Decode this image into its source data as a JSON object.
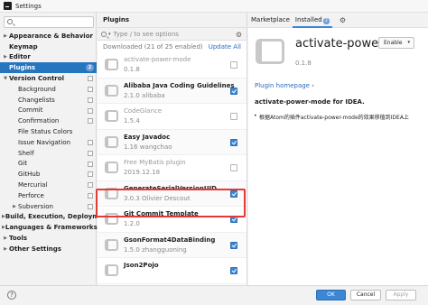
{
  "window": {
    "title": "Settings"
  },
  "sidebar": {
    "search_placeholder": "",
    "items": [
      {
        "label": "Appearance & Behavior",
        "arrow": "▶",
        "bold": true,
        "indent": 0,
        "selected": false,
        "copy": false,
        "badge": ""
      },
      {
        "label": "Keymap",
        "arrow": "",
        "bold": true,
        "indent": 0,
        "selected": false,
        "copy": false,
        "badge": ""
      },
      {
        "label": "Editor",
        "arrow": "▶",
        "bold": true,
        "indent": 0,
        "selected": false,
        "copy": false,
        "badge": ""
      },
      {
        "label": "Plugins",
        "arrow": "",
        "bold": true,
        "indent": 0,
        "selected": true,
        "copy": false,
        "badge": "2"
      },
      {
        "label": "Version Control",
        "arrow": "▼",
        "bold": true,
        "indent": 0,
        "selected": false,
        "copy": true,
        "badge": ""
      },
      {
        "label": "Background",
        "arrow": "",
        "bold": false,
        "indent": 1,
        "selected": false,
        "copy": true,
        "badge": ""
      },
      {
        "label": "Changelists",
        "arrow": "",
        "bold": false,
        "indent": 1,
        "selected": false,
        "copy": true,
        "badge": ""
      },
      {
        "label": "Commit",
        "arrow": "",
        "bold": false,
        "indent": 1,
        "selected": false,
        "copy": true,
        "badge": ""
      },
      {
        "label": "Confirmation",
        "arrow": "",
        "bold": false,
        "indent": 1,
        "selected": false,
        "copy": true,
        "badge": ""
      },
      {
        "label": "File Status Colors",
        "arrow": "",
        "bold": false,
        "indent": 1,
        "selected": false,
        "copy": false,
        "badge": ""
      },
      {
        "label": "Issue Navigation",
        "arrow": "",
        "bold": false,
        "indent": 1,
        "selected": false,
        "copy": true,
        "badge": ""
      },
      {
        "label": "Shelf",
        "arrow": "",
        "bold": false,
        "indent": 1,
        "selected": false,
        "copy": true,
        "badge": ""
      },
      {
        "label": "Git",
        "arrow": "",
        "bold": false,
        "indent": 1,
        "selected": false,
        "copy": true,
        "badge": ""
      },
      {
        "label": "GitHub",
        "arrow": "",
        "bold": false,
        "indent": 1,
        "selected": false,
        "copy": true,
        "badge": ""
      },
      {
        "label": "Mercurial",
        "arrow": "",
        "bold": false,
        "indent": 1,
        "selected": false,
        "copy": true,
        "badge": ""
      },
      {
        "label": "Perforce",
        "arrow": "",
        "bold": false,
        "indent": 1,
        "selected": false,
        "copy": true,
        "badge": ""
      },
      {
        "label": "Subversion",
        "arrow": "▶",
        "bold": false,
        "indent": 1,
        "selected": false,
        "copy": true,
        "badge": ""
      },
      {
        "label": "Build, Execution, Deployment",
        "arrow": "▶",
        "bold": true,
        "indent": 0,
        "selected": false,
        "copy": false,
        "badge": ""
      },
      {
        "label": "Languages & Frameworks",
        "arrow": "▶",
        "bold": true,
        "indent": 0,
        "selected": false,
        "copy": false,
        "badge": ""
      },
      {
        "label": "Tools",
        "arrow": "▶",
        "bold": true,
        "indent": 0,
        "selected": false,
        "copy": false,
        "badge": ""
      },
      {
        "label": "Other Settings",
        "arrow": "▶",
        "bold": true,
        "indent": 0,
        "selected": false,
        "copy": false,
        "badge": ""
      }
    ]
  },
  "plugins_panel": {
    "header": "Plugins",
    "search_placeholder": "Type / to see options",
    "search_dropdown_icon": "chevron-down-icon",
    "installed_summary": "Downloaded (21 of 25 enabled)",
    "update_all": "Update All",
    "list": [
      {
        "name": "activate-power-mode",
        "sub": "0.1.8",
        "enabled": false
      },
      {
        "name": "Alibaba Java Coding Guidelines",
        "sub": "2.1.0  alibaba",
        "enabled": true
      },
      {
        "name": "CodeGlance",
        "sub": "1.5.4",
        "enabled": false
      },
      {
        "name": "Easy Javadoc",
        "sub": "1.16  wangchao",
        "enabled": true
      },
      {
        "name": "Free MyBatis plugin",
        "sub": "2019.12.18",
        "enabled": false
      },
      {
        "name": "GenerateSerialVersionUID",
        "sub": "3.0.3  Olivier Descout",
        "enabled": true
      },
      {
        "name": "Git Commit Template",
        "sub": "1.2.0",
        "enabled": true
      },
      {
        "name": "GsonFormat4DataBinding",
        "sub": "1.5.0  zhangguoning",
        "enabled": true
      },
      {
        "name": "Json2Pojo",
        "sub": "",
        "enabled": true
      }
    ]
  },
  "tabs": {
    "marketplace": "Marketplace",
    "installed": "Installed",
    "installed_count": "2"
  },
  "detail": {
    "name": "activate-powe",
    "enable_label": "Enable",
    "version": "0.1.8",
    "homepage": "Plugin homepage ›",
    "desc_title": "activate-power-mode for IDEA.",
    "desc_item": "根据Atom的插件activate-power-mode的效果移植到IDEA上"
  },
  "footer": {
    "help": "?",
    "ok": "OK",
    "cancel": "Cancel",
    "apply": "Apply"
  },
  "colors": {
    "accent": "#3c86d4",
    "selection": "#2675bf",
    "highlight_border": "#e53935"
  }
}
